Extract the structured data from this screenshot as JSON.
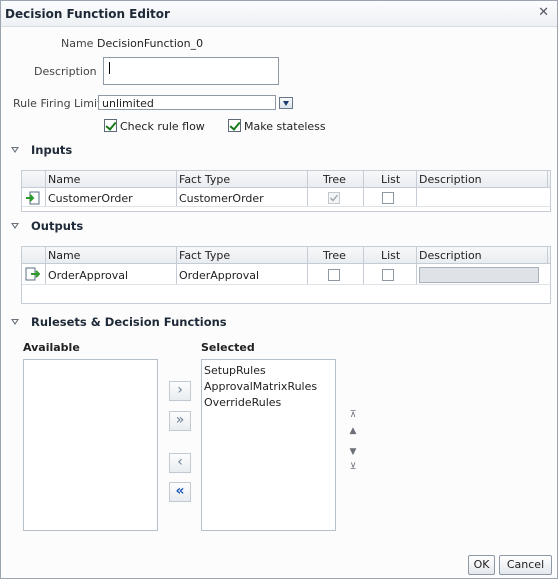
{
  "dialog": {
    "title": "Decision Function Editor",
    "close_glyph": "✕"
  },
  "form": {
    "name_label": "Name",
    "name_value": "DecisionFunction_0",
    "description_label": "Description",
    "description_value": "",
    "rule_limit_label": "Rule Firing Limit",
    "rule_limit_value": "unlimited",
    "check_rule_flow_label": "Check rule flow",
    "check_rule_flow_checked": true,
    "make_stateless_label": "Make stateless",
    "make_stateless_checked": true
  },
  "inputs": {
    "header": "Inputs",
    "columns": [
      "Name",
      "Fact Type",
      "Tree",
      "List",
      "Description"
    ],
    "rows": [
      {
        "name": "CustomerOrder",
        "fact_type": "CustomerOrder",
        "tree": true,
        "list": false,
        "description": ""
      }
    ]
  },
  "outputs": {
    "header": "Outputs",
    "columns": [
      "Name",
      "Fact Type",
      "Tree",
      "List",
      "Description"
    ],
    "rows": [
      {
        "name": "OrderApproval",
        "fact_type": "OrderApproval",
        "tree": false,
        "list": false,
        "description": ""
      }
    ]
  },
  "rulesets": {
    "header": "Rulesets & Decision Functions",
    "available_label": "Available",
    "selected_label": "Selected",
    "available_items": [],
    "selected_items": [
      "SetupRules",
      "ApprovalMatrixRules",
      "OverrideRules"
    ],
    "move_right": "›",
    "move_all_right": "»",
    "move_left": "‹",
    "move_all_left": "«",
    "order_top": "⊼",
    "order_up": "▲",
    "order_down": "▼",
    "order_bottom": "⊻"
  },
  "buttons": {
    "ok": "OK",
    "cancel": "Cancel"
  },
  "colors": {
    "accent": "#1d59b6",
    "check": "#187a18"
  }
}
